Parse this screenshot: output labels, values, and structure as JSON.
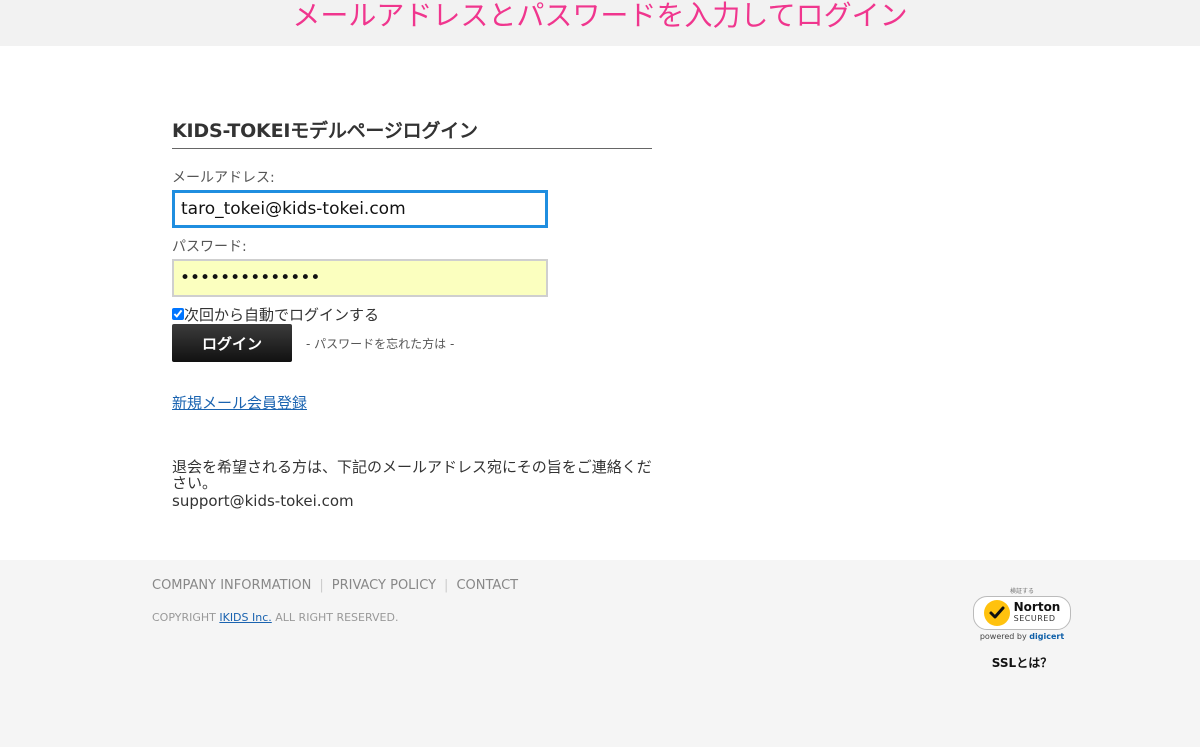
{
  "header": {
    "title": "メールアドレスとパスワードを入力してログイン"
  },
  "login": {
    "heading": "KIDS-TOKEIモデルページログイン",
    "email_label": "メールアドレス:",
    "email_value": "taro_tokei@kids-tokei.com",
    "password_label": "パスワード:",
    "password_value": "••••••••••••••",
    "remember_label": "次回から自動でログインする",
    "remember_checked": true,
    "login_button": "ログイン",
    "forgot_link": "- パスワードを忘れた方は -",
    "register_link": "新規メール会員登録",
    "withdraw_text": "退会を希望される方は、下記のメールアドレス宛にその旨をご連絡ください。",
    "support_email": "support@kids-tokei.com"
  },
  "footer": {
    "nav": [
      "COMPANY INFORMATION",
      "PRIVACY POLICY",
      "CONTACT"
    ],
    "copyright_prefix": "COPYRIGHT",
    "copyright_company": "IKIDS Inc.",
    "copyright_suffix": "ALL RIGHT RESERVED.",
    "norton": {
      "verify": "検証する",
      "brand": "Norton",
      "secured": "SECURED",
      "powered_prefix": "powered by",
      "powered_brand": "digicert",
      "ssl_link": "SSLとは？"
    }
  },
  "colors": {
    "title_pink": "#f0368e",
    "focus_blue": "#1f8ee0",
    "password_fill": "#fbffbf",
    "link_blue": "#1a63b0",
    "norton_yellow": "#ffc20e"
  }
}
